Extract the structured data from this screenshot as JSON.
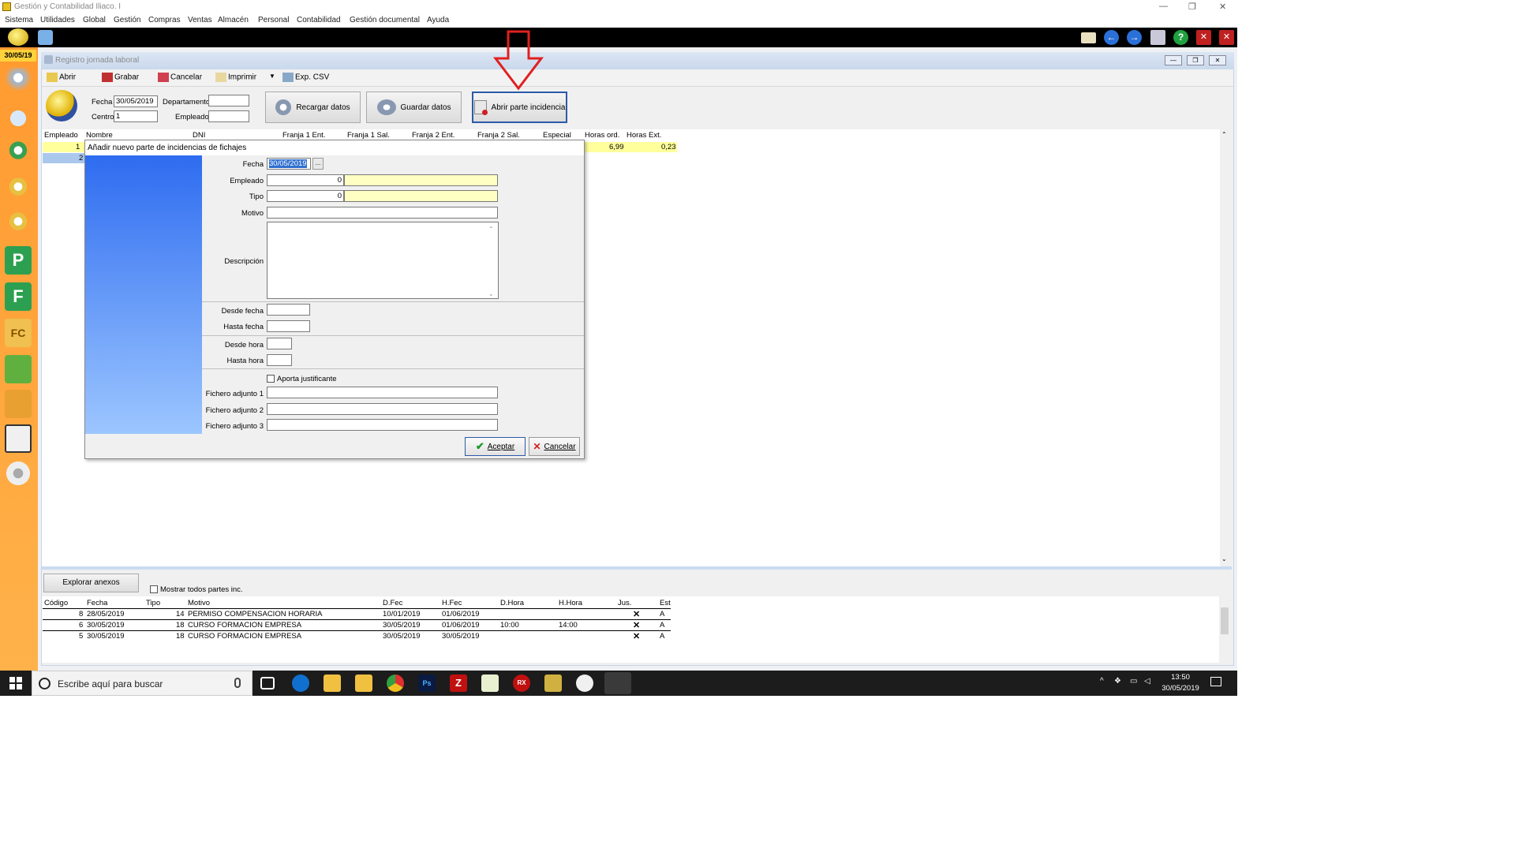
{
  "app": {
    "title": "Gestión y Contabilidad Iliaco. I"
  },
  "menu": [
    "Sistema",
    "Utilidades",
    "Global",
    "Gestión",
    "Compras",
    "Ventas",
    "Almacén",
    "Personal",
    "Contabilidad",
    "Gestión documental",
    "Ayuda"
  ],
  "date_tag": "30/05/19",
  "child_window": {
    "title": "Registro jornada laboral"
  },
  "toolbar": {
    "abrir": "Abrir",
    "grabar": "Grabar",
    "cancelar": "Cancelar",
    "imprimir": "Imprimir",
    "exp_csv": "Exp. CSV"
  },
  "filters": {
    "fecha_label": "Fecha",
    "fecha_value": "30/05/2019",
    "departamento_label": "Departamento",
    "centro_label": "Centro",
    "centro_value": "1",
    "empleado_label": "Empleado"
  },
  "buttons": {
    "recargar": "Recargar datos",
    "guardar": "Guardar datos",
    "abrir_parte": "Abrir parte incidencia"
  },
  "grid": {
    "columns": [
      "Empleado",
      "Nombre",
      "DNI",
      "Franja 1 Ent.",
      "Franja 1 Sal.",
      "Franja 2 Ent.",
      "Franja 2 Sal.",
      "Especial",
      "Horas ord.",
      "Horas Ext."
    ],
    "rows": [
      {
        "empleado": "1",
        "horas_ord": "6,99",
        "horas_ext": "0,23"
      },
      {
        "empleado": "2"
      }
    ]
  },
  "dialog": {
    "title": "Añadir nuevo parte de incidencias de fichajes",
    "fecha_label": "Fecha",
    "fecha_value": "30/05/2019",
    "ellipsis": "...",
    "empleado_label": "Empleado",
    "empleado_value": "0",
    "tipo_label": "Tipo",
    "tipo_value": "0",
    "motivo_label": "Motivo",
    "descripcion_label": "Descripción",
    "desde_fecha_label": "Desde fecha",
    "hasta_fecha_label": "Hasta fecha",
    "desde_hora_label": "Desde hora",
    "hasta_hora_label": "Hasta hora",
    "aporta_label": "Aporta justificante",
    "fichero1_label": "Fichero adjunto 1",
    "fichero2_label": "Fichero adjunto 2",
    "fichero3_label": "Fichero adjunto 3",
    "aceptar": "Aceptar",
    "cancelar": "Cancelar"
  },
  "bottom": {
    "explorar": "Explorar anexos",
    "mostrar": "Mostrar todos partes inc.",
    "columns": [
      "Código",
      "Fecha",
      "Tipo",
      "Motivo",
      "D.Fec",
      "H.Fec",
      "D.Hora",
      "H.Hora",
      "Jus.",
      "Est"
    ],
    "rows": [
      {
        "codigo": "8",
        "fecha": "28/05/2019",
        "tipo": "14",
        "motivo": "PERMISO COMPENSACION HORARIA",
        "dfec": "10/01/2019",
        "hfec": "01/06/2019",
        "dhora": "",
        "hhora": "",
        "jus": "✕",
        "est": "A"
      },
      {
        "codigo": "6",
        "fecha": "30/05/2019",
        "tipo": "18",
        "motivo": "CURSO FORMACION EMPRESA",
        "dfec": "30/05/2019",
        "hfec": "01/06/2019",
        "dhora": "10:00",
        "hhora": "14:00",
        "jus": "✕",
        "est": "A"
      },
      {
        "codigo": "5",
        "fecha": "30/05/2019",
        "tipo": "18",
        "motivo": "CURSO FORMACION EMPRESA",
        "dfec": "30/05/2019",
        "hfec": "30/05/2019",
        "dhora": "",
        "hhora": "",
        "jus": "✕",
        "est": "A"
      }
    ]
  },
  "taskbar": {
    "search_placeholder": "Escribe aquí para buscar",
    "time": "13:50",
    "date": "30/05/2019"
  },
  "colors": {
    "accent_arrow": "#e02020",
    "yellow_row": "#ffff9c",
    "selected_row": "#aac8ec",
    "leftbar": "#ff9a30"
  }
}
